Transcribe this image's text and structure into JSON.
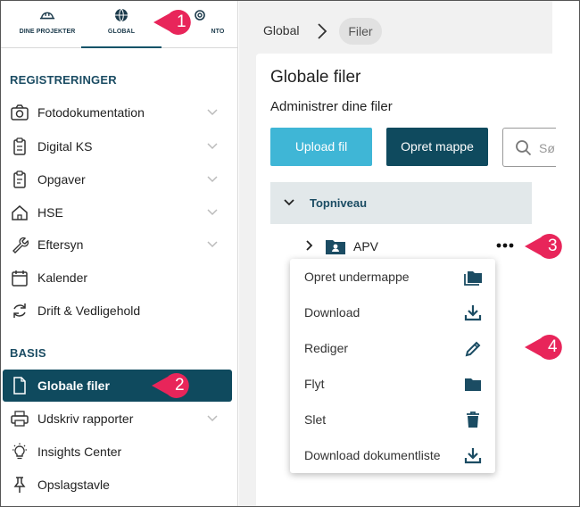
{
  "topnav": {
    "items": [
      {
        "label": "DINE PROJEKTER",
        "icon": "hardhat-icon"
      },
      {
        "label": "GLOBAL",
        "icon": "globe-icon"
      },
      {
        "label": "NTO",
        "icon": "gear-icon"
      }
    ]
  },
  "sidebar": {
    "section_registreringer": "REGISTRERINGER",
    "section_basis": "BASIS",
    "items": [
      {
        "label": "Fotodokumentation",
        "icon": "camera-icon"
      },
      {
        "label": "Digital KS",
        "icon": "clipboard-icon"
      },
      {
        "label": "Opgaver",
        "icon": "clipboard-check-icon"
      },
      {
        "label": "HSE",
        "icon": "house-icon"
      },
      {
        "label": "Eftersyn",
        "icon": "wrench-icon"
      },
      {
        "label": "Kalender",
        "icon": "calendar-icon"
      },
      {
        "label": "Drift & Vedligehold",
        "icon": "refresh-icon"
      },
      {
        "label": "Globale filer",
        "icon": "file-icon"
      },
      {
        "label": "Udskriv rapporter",
        "icon": "printer-icon"
      },
      {
        "label": "Insights Center",
        "icon": "lightbulb-icon"
      },
      {
        "label": "Opslagstavle",
        "icon": "pin-icon"
      }
    ]
  },
  "breadcrumb": {
    "root": "Global",
    "current": "Filer"
  },
  "main": {
    "title": "Globale filer",
    "subtitle": "Administrer dine filer",
    "upload_label": "Upload fil",
    "create_folder_label": "Opret mappe",
    "search_placeholder": "Sø"
  },
  "tree": {
    "root_label": "Topniveau",
    "folder_label": "APV"
  },
  "context_menu": {
    "items": [
      {
        "label": "Opret undermappe",
        "icon": "folders-icon"
      },
      {
        "label": "Download",
        "icon": "download-icon"
      },
      {
        "label": "Rediger",
        "icon": "pencil-icon"
      },
      {
        "label": "Flyt",
        "icon": "folder-icon"
      },
      {
        "label": "Slet",
        "icon": "trash-icon"
      },
      {
        "label": "Download dokumentliste",
        "icon": "download-icon"
      }
    ]
  },
  "callouts": {
    "one": "1",
    "two": "2",
    "three": "3",
    "four": "4"
  },
  "colors": {
    "primary": "#0f4a5e",
    "accent": "#3fb6d6",
    "callout": "#e8255a"
  }
}
